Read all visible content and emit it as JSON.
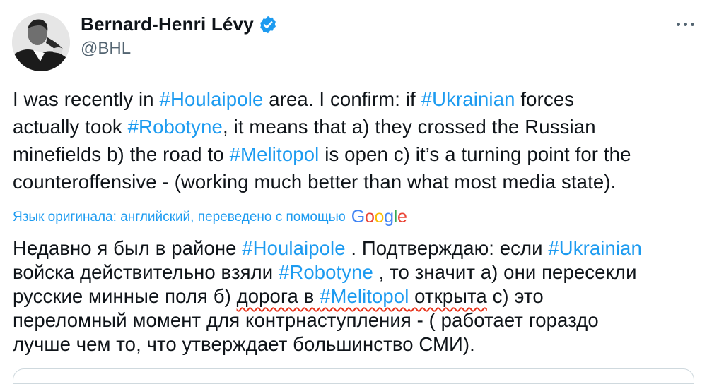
{
  "author": {
    "name": "Bernard-Henri Lévy",
    "handle": "@BHL"
  },
  "icons": {
    "verified": "verified-badge-icon",
    "more": "more-options-icon",
    "google": "google-logo"
  },
  "colors": {
    "link": "#1d9bf0",
    "text": "#0f1419",
    "secondary": "#536471",
    "verified": "#1d9bf0",
    "underline": "#e8341c"
  },
  "tweet": {
    "lines": [
      {
        "t1": "I was recently in ",
        "h1": "#Houlaipole",
        "t2": " area. I confirm: if ",
        "h2": "#Ukrainian",
        "t3": " forces"
      },
      {
        "t1": "actually took ",
        "h1": "#Robotyne",
        "t2": ", it means that a) they crossed the Russian"
      },
      {
        "t1": "minefields b) the road to ",
        "h1": "#Melitopol",
        "t2": " is open c) it’s a turning point for the"
      },
      {
        "t1": "counteroffensive - (working much better than what most media state)."
      }
    ]
  },
  "translation_note": {
    "text": "Язык оригинала: английский, переведено с помощью",
    "brand": [
      "G",
      "o",
      "o",
      "g",
      "l",
      "e"
    ]
  },
  "translation": {
    "lines": [
      {
        "t1": "Недавно я был в районе ",
        "h1": "#Houlaipole",
        "t2": " . Подтверждаю: если ",
        "h2": "#Ukrainian"
      },
      {
        "t1": "войска действительно взяли ",
        "h1": "#Robotyne",
        "t2": " , то значит а) они пересекли"
      },
      {
        "t1": "русские минные поля б) ",
        "u1": "дорога в ",
        "h1": "#Melitopol",
        "u2": " открыта",
        "t2": " с) это"
      },
      {
        "t1": "переломный момент для контрнаступления - ( работает гораздо"
      },
      {
        "t1": "лучше чем то, что утверждает большинство СМИ)."
      }
    ]
  }
}
